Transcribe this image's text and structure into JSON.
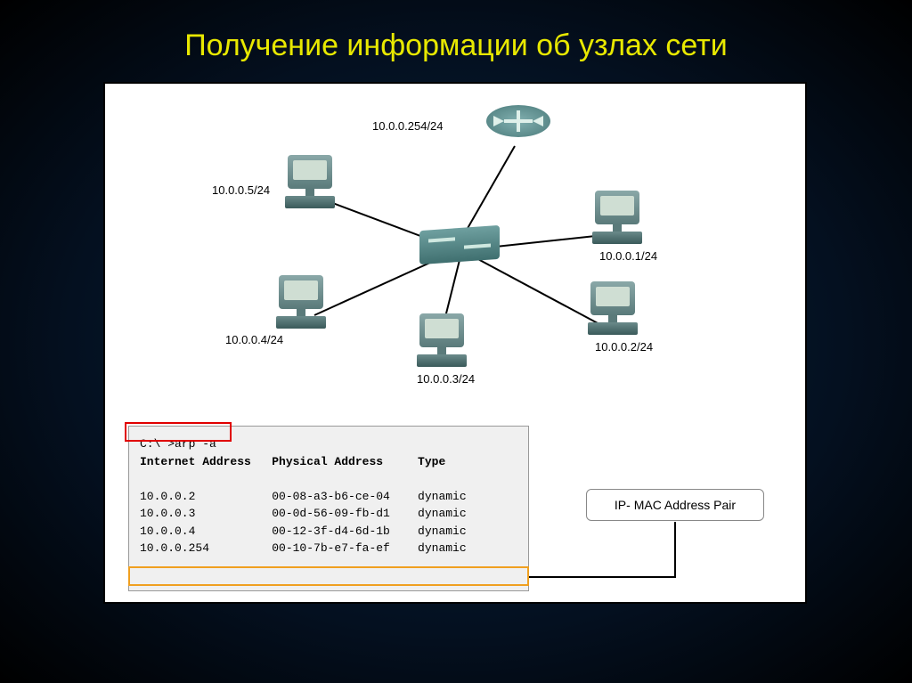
{
  "title": "Получение информации об узлах сети",
  "network": {
    "router_label": "10.0.0.254/24",
    "hosts": {
      "pc1": "10.0.0.1/24",
      "pc2": "10.0.0.2/24",
      "pc3": "10.0.0.3/24",
      "pc4": "10.0.0.4/24",
      "pc5": "10.0.0.5/24"
    }
  },
  "terminal": {
    "command": "C:\\ >arp -a",
    "headers": "Internet Address   Physical Address     Type",
    "rows": [
      "10.0.0.2           00-08-a3-b6-ce-04    dynamic",
      "10.0.0.3           00-0d-56-09-fb-d1    dynamic",
      "10.0.0.4           00-12-3f-d4-6d-1b    dynamic",
      "10.0.0.254         00-10-7b-e7-fa-ef    dynamic"
    ]
  },
  "callout": {
    "label": "IP- MAC Address Pair"
  }
}
